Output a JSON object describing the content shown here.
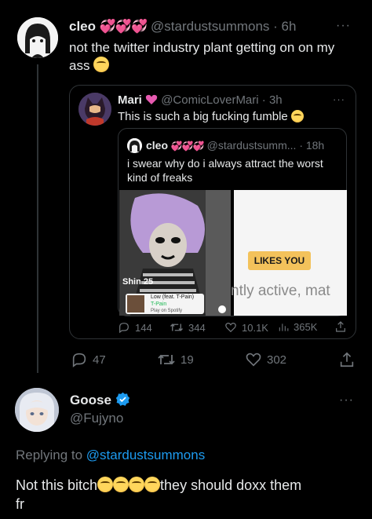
{
  "main_post": {
    "name": "cleo",
    "hearts": "💞💞💞",
    "handle": "@stardustsummons",
    "time": "· 6h",
    "text_line1": "not the twitter industry plant getting on on my",
    "text_line2": "ass",
    "more": "···",
    "actions": {
      "replies": "47",
      "retweets": "19",
      "likes": "302"
    }
  },
  "quote": {
    "name": "Mari",
    "handle": "@ComicLoverMari",
    "time": "· 3h",
    "text": "This is such a big fucking fumble",
    "more": "···",
    "nested": {
      "name": "cleo",
      "hearts": "💞💞💞",
      "handle": "@stardustsumm...",
      "time": "· 18h",
      "text_line1": "i swear why do i always attract the worst",
      "text_line2": "kind of freaks",
      "media": {
        "profile_name": "Shin",
        "profile_age": "25",
        "song_title": "Low (feat. T-Pain)",
        "song_artist": "T-Pain",
        "song_source": "Play on Spotify",
        "badge": "LIKES YOU",
        "active_text": "ntly active, mat"
      }
    },
    "actions": {
      "replies": "144",
      "retweets": "344",
      "likes": "10.1K",
      "views": "365K"
    }
  },
  "reply": {
    "name": "Goose",
    "handle": "@Fujyno",
    "more": "···",
    "replying_prefix": "Replying to",
    "replying_handle": "@stardustsummons",
    "text_part1": "Not this bitch",
    "text_part2": "they should doxx them",
    "text_line2": "fr"
  },
  "colors": {
    "accent": "#1d9bf0",
    "muted": "#71767b",
    "text": "#e7e9ea",
    "heart": "#f91880"
  }
}
